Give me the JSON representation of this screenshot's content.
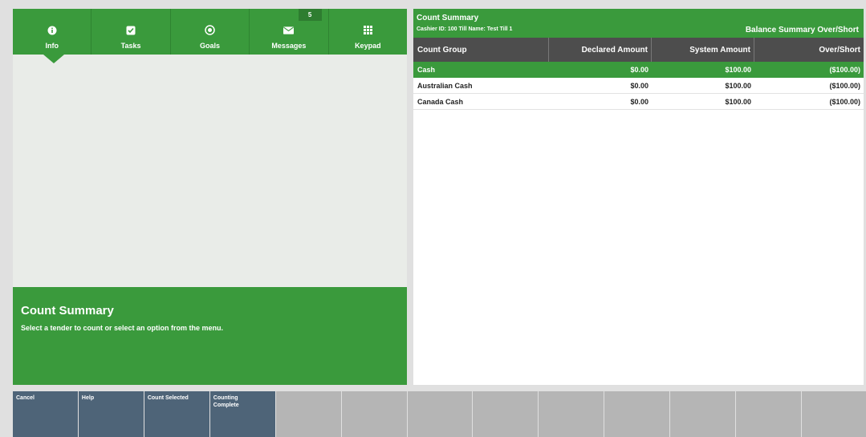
{
  "nav": {
    "tabs": [
      {
        "label": "Info",
        "icon": "info-icon"
      },
      {
        "label": "Tasks",
        "icon": "checkbox-icon"
      },
      {
        "label": "Goals",
        "icon": "target-icon"
      },
      {
        "label": "Messages",
        "icon": "envelope-icon",
        "badge": "5"
      },
      {
        "label": "Keypad",
        "icon": "keypad-icon"
      }
    ],
    "selected": "Info"
  },
  "info_box": {
    "title": "Count Summary",
    "text": "Select a tender to count or select an option from the menu."
  },
  "summary": {
    "title": "Count Summary",
    "subtitle": "Cashier ID: 100 Till Name: Test Till 1",
    "right_title": "Balance Summary Over/Short",
    "columns": [
      "Count Group",
      "Declared Amount",
      "System Amount",
      "Over/Short"
    ],
    "rows": [
      {
        "group": "Cash",
        "declared": "$0.00",
        "system": "$100.00",
        "over_short": "($100.00)",
        "selected": true
      },
      {
        "group": "Australian Cash",
        "declared": "$0.00",
        "system": "$100.00",
        "over_short": "($100.00)",
        "selected": false
      },
      {
        "group": "Canada Cash",
        "declared": "$0.00",
        "system": "$100.00",
        "over_short": "($100.00)",
        "selected": false
      }
    ]
  },
  "buttons": {
    "cancel": "Cancel",
    "help": "Help",
    "count_selected": "Count Selected",
    "counting_complete_1": "Counting",
    "counting_complete_2": "Complete"
  },
  "colors": {
    "accent_green": "#3a9a3c",
    "header_dark": "#4d4d4d",
    "button_blue": "#4e6478",
    "button_empty": "#b5b5b5"
  }
}
